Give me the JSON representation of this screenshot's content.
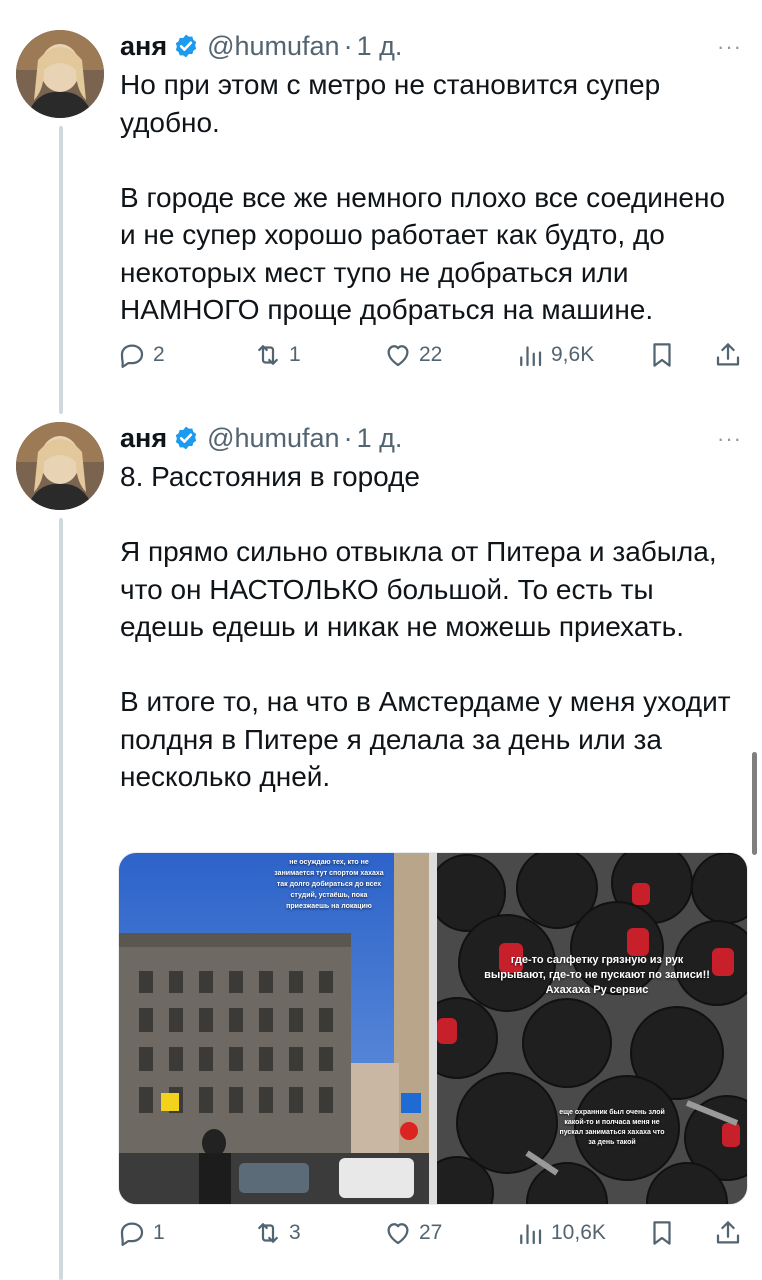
{
  "tweets": [
    {
      "author": "аня",
      "handle": "@humufan",
      "separator": "·",
      "time": "1 д.",
      "paragraphs": [
        "Но при этом с метро не становится супер удобно.",
        "В городе все же немного плохо все соединено и не супер хорошо работает как будто, до некоторых мест тупо не добраться или НАМНОГО проще добраться на машине."
      ],
      "stats": {
        "replies": "2",
        "reposts": "1",
        "likes": "22",
        "views": "9,6K"
      }
    },
    {
      "author": "аня",
      "handle": "@humufan",
      "separator": "·",
      "time": "1 д.",
      "paragraphs": [
        "8. Расстояния в городе",
        "Я прямо сильно отвыкла от Питера и забыла, что он НАСТОЛЬКО большой. То есть ты едешь едешь и никак не можешь приехать.",
        "В итоге то, на что в Амстердаме у меня уходит полдня в Питере я делала за день или за несколько дней."
      ],
      "media": {
        "left_caption": "не осуждаю тех, кто не занимается тут спортом хахаха так долго добираться до всех студий, устаёшь, пока приезжаешь на локацию",
        "right_caption_main": "где-то салфетку грязную из рук вырывают, где-то не пускают по записи!! Ахахаха Ру сервис",
        "right_caption_small": "еще охранник был очень злой какой-то и полчаса меня не пускал заниматься хахаха что за день такой"
      },
      "stats": {
        "replies": "1",
        "reposts": "3",
        "likes": "27",
        "views": "10,6K"
      }
    }
  ],
  "more_label": "···",
  "colors": {
    "text": "#0f1419",
    "muted": "#536471",
    "verified": "#1d9bf0",
    "thread": "#cfd9de"
  }
}
